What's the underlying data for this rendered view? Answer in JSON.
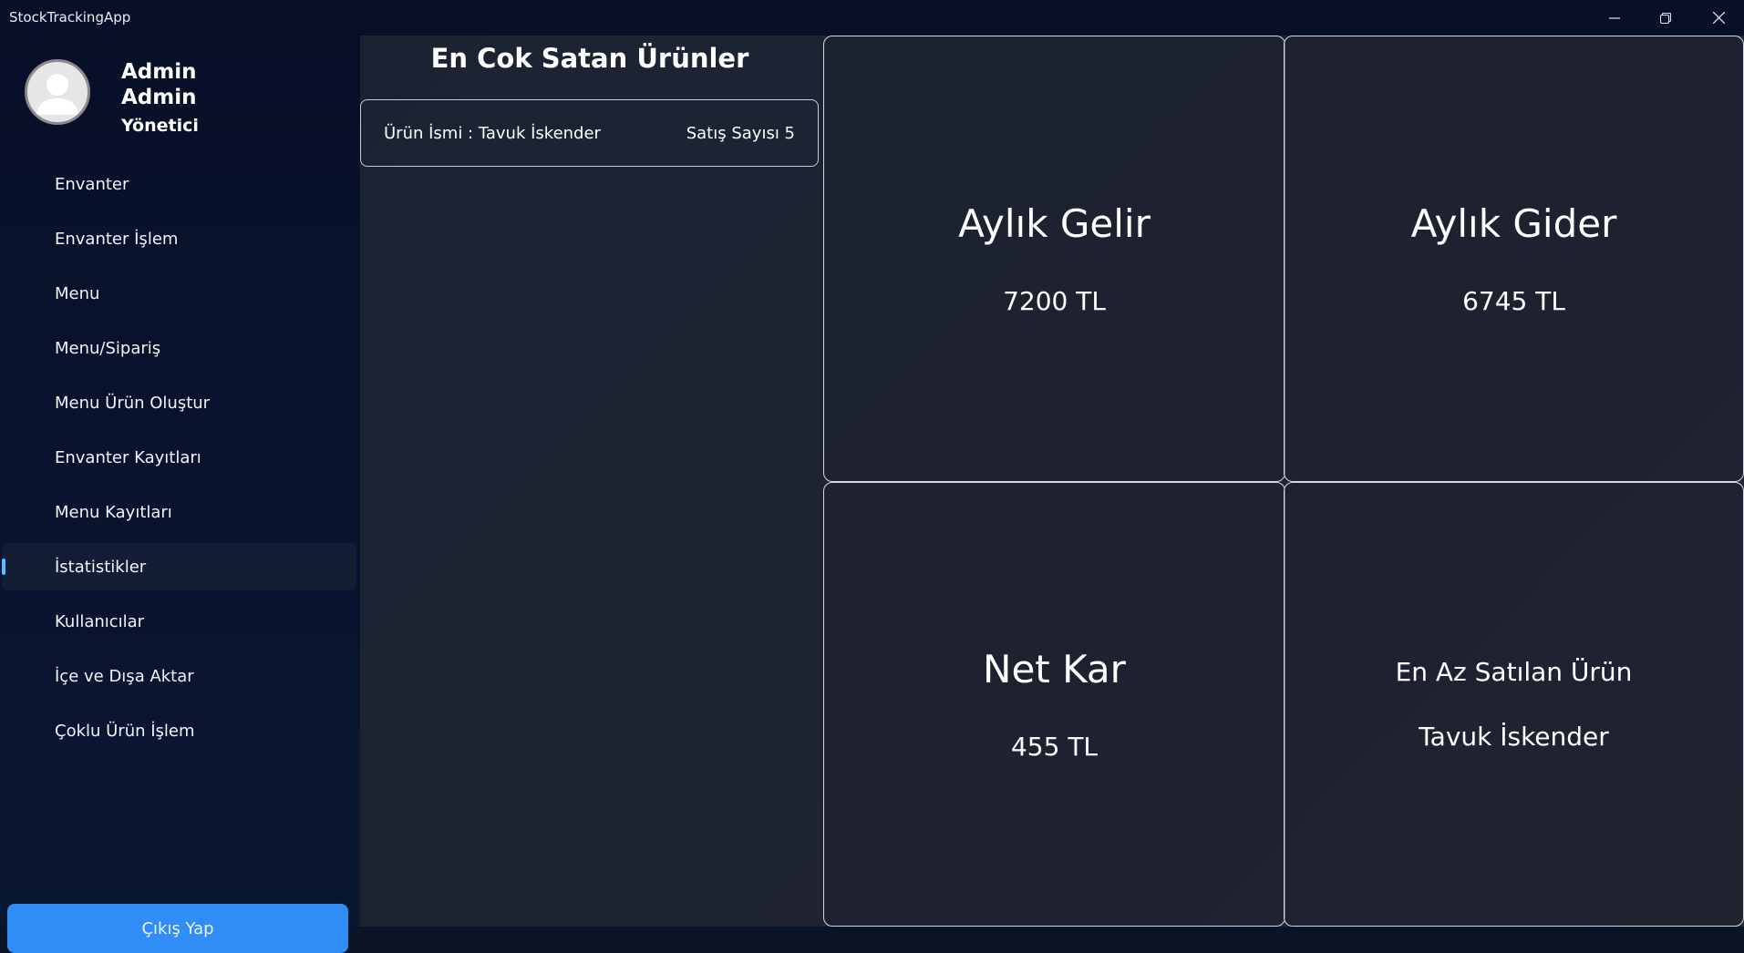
{
  "window": {
    "title": "StockTrackingApp",
    "controls": [
      "minimize-icon",
      "restore-icon",
      "close-icon"
    ]
  },
  "user": {
    "first_name": "Admin",
    "last_name": "Admin",
    "role": "Yönetici"
  },
  "nav": {
    "items": [
      {
        "label": "Envanter"
      },
      {
        "label": "Envanter İşlem"
      },
      {
        "label": "Menu"
      },
      {
        "label": "Menu/Sipariş"
      },
      {
        "label": "Menu Ürün Oluştur"
      },
      {
        "label": "Envanter Kayıtları"
      },
      {
        "label": "Menu Kayıtları"
      },
      {
        "label": "İstatistikler",
        "active": true
      },
      {
        "label": "Kullanıcılar"
      },
      {
        "label": "İçe ve Dışa Aktar"
      },
      {
        "label": "Çoklu Ürün İşlem"
      }
    ],
    "logout_label": "Çıkış Yap"
  },
  "best_sellers": {
    "title": "En Cok Satan Ürünler",
    "items": [
      {
        "name_text": "Ürün İsmi : Tavuk İskender",
        "count_text": "Satış Sayısı 5"
      }
    ]
  },
  "stats": {
    "monthly_income": {
      "title": "Aylık Gelir",
      "value": "7200 TL"
    },
    "monthly_expense": {
      "title": "Aylık Gider",
      "value": "6745 TL"
    },
    "net_profit": {
      "title": "Net Kar",
      "value": "455 TL"
    },
    "least_sold": {
      "title": "En Az Satılan Ürün",
      "value": "Tavuk İskender"
    }
  },
  "colors": {
    "accent": "#2f8df5",
    "active_indicator": "#5cb8ff",
    "sidebar_bg": "#071027",
    "content_bg": "#1e2330"
  }
}
